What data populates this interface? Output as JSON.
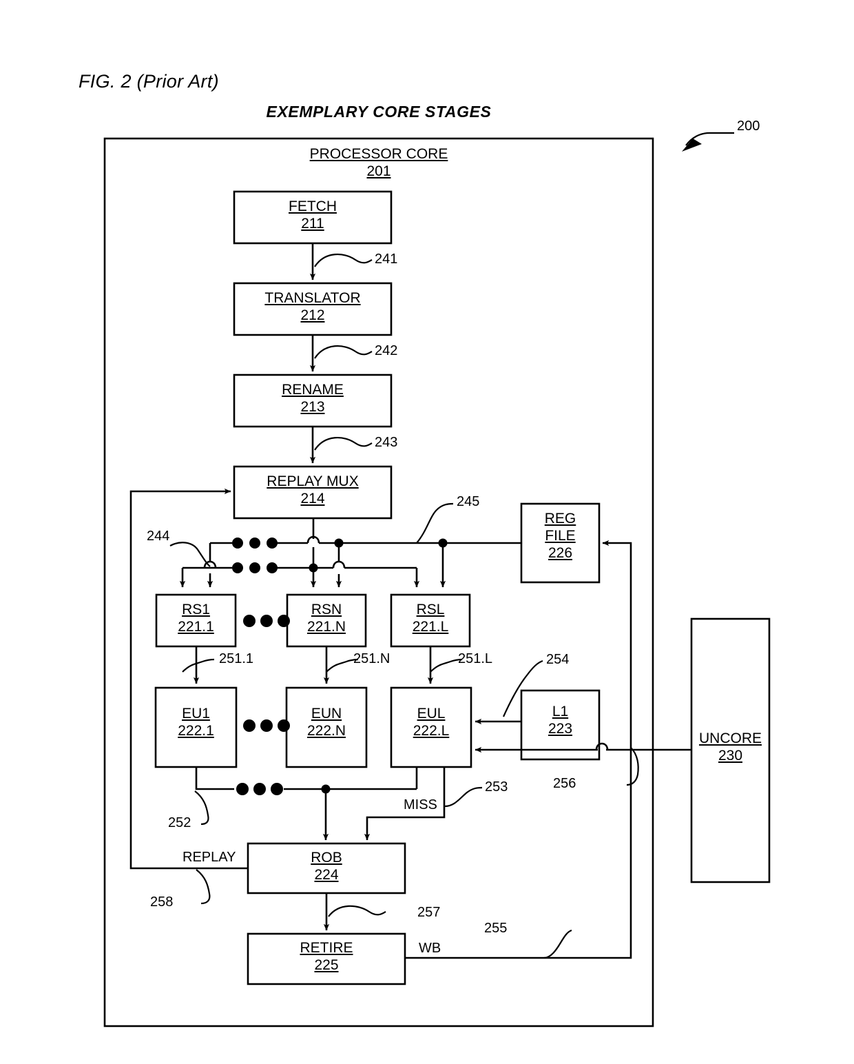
{
  "figure": {
    "label": "FIG. 2 (Prior Art)",
    "title": "EXEMPLARY CORE STAGES",
    "diagram_ref": "200"
  },
  "container": {
    "name": "PROCESSOR CORE",
    "ref": "201"
  },
  "blocks": [
    {
      "id": "fetch",
      "name": "FETCH",
      "ref": "211"
    },
    {
      "id": "translator",
      "name": "TRANSLATOR",
      "ref": "212"
    },
    {
      "id": "rename",
      "name": "RENAME",
      "ref": "213"
    },
    {
      "id": "replay_mux",
      "name": "REPLAY MUX",
      "ref": "214"
    },
    {
      "id": "rs1",
      "name": "RS1",
      "ref": "221.1"
    },
    {
      "id": "rsn",
      "name": "RSN",
      "ref": "221.N"
    },
    {
      "id": "rsl",
      "name": "RSL",
      "ref": "221.L"
    },
    {
      "id": "eu1",
      "name": "EU1",
      "ref": "222.1"
    },
    {
      "id": "eun",
      "name": "EUN",
      "ref": "222.N"
    },
    {
      "id": "eul",
      "name": "EUL",
      "ref": "222.L"
    },
    {
      "id": "l1",
      "name": "L1",
      "ref": "223"
    },
    {
      "id": "rob",
      "name": "ROB",
      "ref": "224"
    },
    {
      "id": "retire",
      "name": "RETIRE",
      "ref": "225"
    },
    {
      "id": "reg_file",
      "name": "REG\nFILE",
      "ref": "226"
    },
    {
      "id": "uncore",
      "name": "UNCORE",
      "ref": "230"
    }
  ],
  "reg_file_lines": {
    "line1": "REG",
    "line2": "FILE"
  },
  "connector_refs": [
    {
      "id": "c241",
      "ref": "241",
      "from": "fetch",
      "to": "translator"
    },
    {
      "id": "c242",
      "ref": "242",
      "from": "translator",
      "to": "rename"
    },
    {
      "id": "c243",
      "ref": "243",
      "from": "rename",
      "to": "replay_mux"
    },
    {
      "id": "c244",
      "ref": "244",
      "from": "bus",
      "to": "rs1"
    },
    {
      "id": "c245",
      "ref": "245",
      "from": "reg_file",
      "to": "bus"
    },
    {
      "id": "c251_1",
      "ref": "251.1",
      "from": "rs1",
      "to": "eu1"
    },
    {
      "id": "c251_n",
      "ref": "251.N",
      "from": "rsn",
      "to": "eun"
    },
    {
      "id": "c251_l",
      "ref": "251.L",
      "from": "rsl",
      "to": "eul"
    },
    {
      "id": "c252",
      "ref": "252",
      "from": "eu1",
      "to": "rob"
    },
    {
      "id": "c253",
      "ref": "253",
      "from": "eul",
      "to": "rob"
    },
    {
      "id": "c254",
      "ref": "254",
      "from": "l1",
      "to": "eul"
    },
    {
      "id": "c255",
      "ref": "255",
      "from": "retire",
      "to": "reg_file"
    },
    {
      "id": "c256",
      "ref": "256",
      "from": "uncore",
      "to": "eul"
    },
    {
      "id": "c257",
      "ref": "257",
      "from": "rob",
      "to": "retire"
    },
    {
      "id": "c258",
      "ref": "258",
      "from": "rob",
      "to": "replay_mux"
    }
  ],
  "signal_labels": [
    {
      "id": "miss",
      "text": "MISS"
    },
    {
      "id": "replay",
      "text": "REPLAY"
    },
    {
      "id": "wb",
      "text": "WB"
    }
  ]
}
